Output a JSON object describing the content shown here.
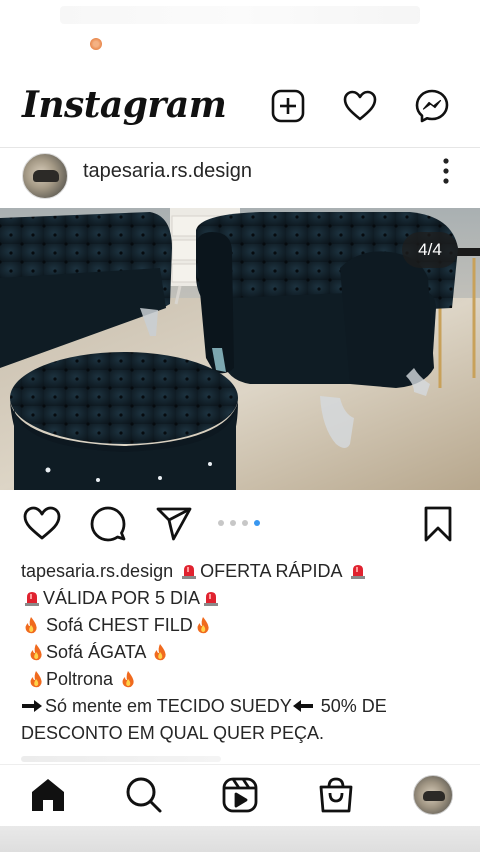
{
  "app": {
    "logo_text": "Instagram"
  },
  "header_icons": [
    "new-post-icon",
    "heart-icon",
    "messenger-icon"
  ],
  "post": {
    "username": "tapesaria.rs.design",
    "page_indicator": "4/4",
    "carousel_total": 4,
    "carousel_current": 4
  },
  "caption": {
    "username": "tapesaria.rs.design",
    "line1": "OFERTA RÁPIDA",
    "line2": "VÁLIDA POR 5 DIA",
    "line3": " Sofá CHEST FILD",
    "line4": "Sofá ÁGATA ",
    "line5": "Poltrona ",
    "line6": "Só mente em TECIDO SUEDY",
    "line6b": " 50% DE",
    "line7": "DESCONTO  EM QUAL QUER PEÇA."
  },
  "action_icons": [
    "like-icon",
    "comment-icon",
    "share-icon",
    "save-icon"
  ],
  "bottom_nav": [
    "home-icon",
    "search-icon",
    "reels-icon",
    "shop-icon",
    "profile-avatar"
  ],
  "colors": {
    "accent_dot": "#3897f0",
    "text": "#262626",
    "siren": "#e0222f",
    "fire": "#f06a1e"
  }
}
